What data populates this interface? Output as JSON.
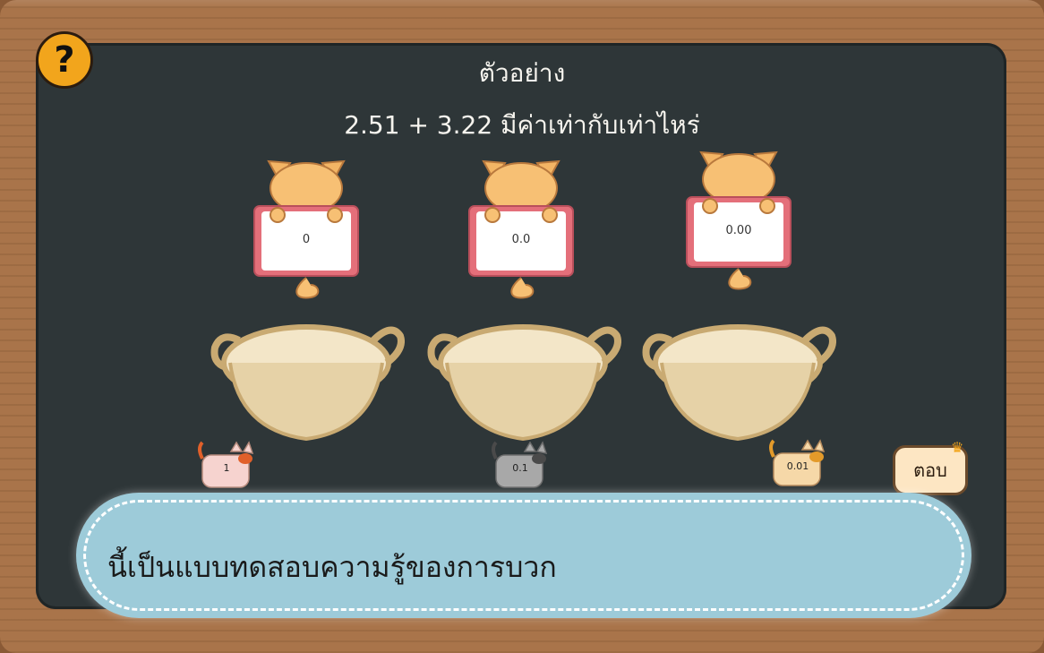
{
  "app": {
    "title": "ตัวอย่าง",
    "question": "2.51 + 3.22 มีค่าเท่ากับเท่าไหร่"
  },
  "toolbar": {
    "help_label": "?"
  },
  "cards": [
    {
      "label": "0"
    },
    {
      "label": "0.0"
    },
    {
      "label": "0.00"
    }
  ],
  "tokens": [
    {
      "label": "1",
      "color": "#f6d3cf"
    },
    {
      "label": "0.1",
      "color": "#a8a8a8"
    },
    {
      "label": "0.01",
      "color": "#f6d8a8"
    }
  ],
  "buttons": {
    "answer_label": "ตอบ"
  },
  "dialog": {
    "text": "นี้เป็นแบบทดสอบความรู้ของการบวก"
  },
  "colors": {
    "board": "#2e3638",
    "frame": "#a9744a",
    "accent": "#f2a51c",
    "dialog": "#9dcbd9"
  },
  "icons": {
    "help": "question-mark-icon",
    "crown": "crown-icon"
  }
}
